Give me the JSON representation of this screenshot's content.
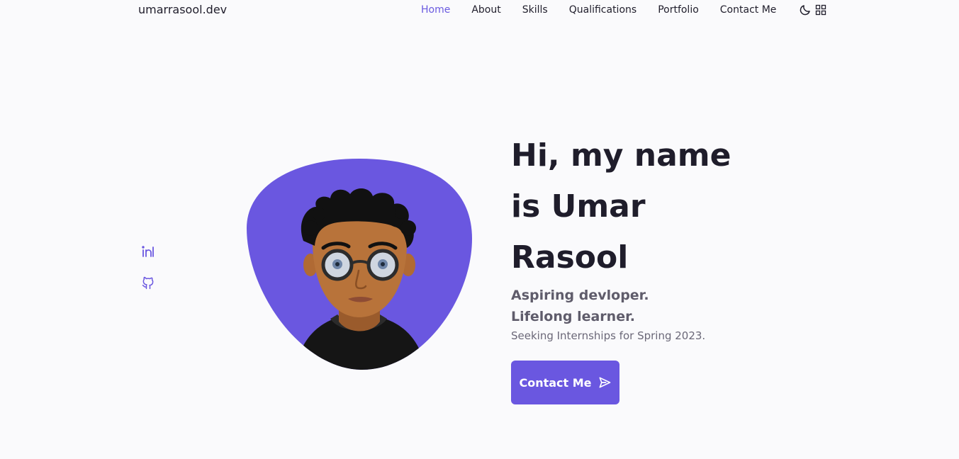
{
  "header": {
    "logo": "umarrasool.dev",
    "nav": [
      {
        "label": "Home",
        "active": true
      },
      {
        "label": "About",
        "active": false
      },
      {
        "label": "Skills",
        "active": false
      },
      {
        "label": "Qualifications",
        "active": false
      },
      {
        "label": "Portfolio",
        "active": false
      },
      {
        "label": "Contact Me",
        "active": false
      }
    ],
    "icons": [
      "moon-icon",
      "grid-icon"
    ]
  },
  "social": {
    "icons": [
      "linkedin-icon",
      "github-icon"
    ]
  },
  "hero": {
    "title_line1": "Hi, my name",
    "title_line2": "is Umar",
    "title_line3": "Rasool",
    "subtitle_line1": "Aspiring devloper.",
    "subtitle_line2": "Lifelong learner.",
    "description": "Seeking Internships for Spring 2023.",
    "button_label": "Contact Me",
    "button_icon": "send-icon"
  },
  "colors": {
    "accent": "#6a57e0",
    "background": "#fafafc",
    "text": "#1f1d2b",
    "muted": "#5f5c6b"
  }
}
